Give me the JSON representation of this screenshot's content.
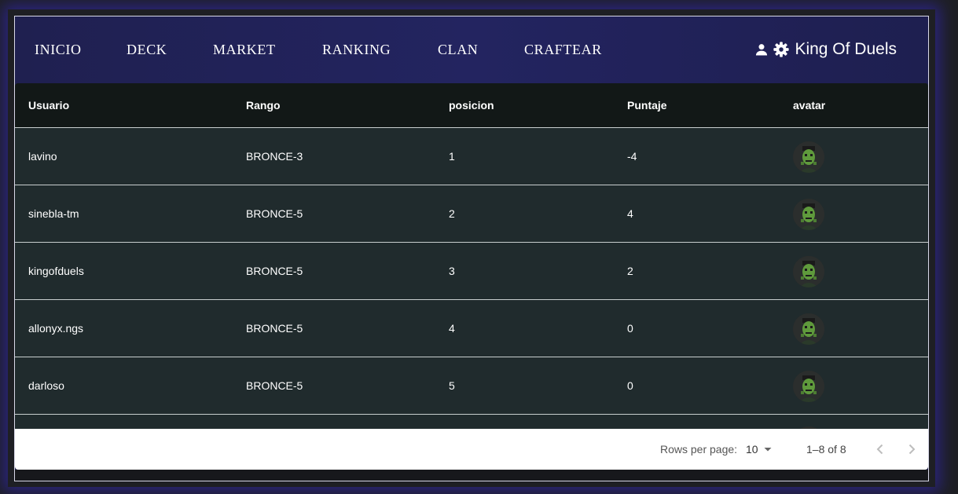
{
  "nav": {
    "items": [
      {
        "label": "INICIO"
      },
      {
        "label": "DECK"
      },
      {
        "label": "MARKET"
      },
      {
        "label": "RANKING"
      },
      {
        "label": "CLAN"
      },
      {
        "label": "CRAFTEAR"
      }
    ],
    "user_icon": "person-icon",
    "settings_icon": "gear-icon",
    "username": "King Of Duels"
  },
  "table": {
    "columns": [
      "Usuario",
      "Rango",
      "posicion",
      "Puntaje",
      "avatar"
    ],
    "rows": [
      {
        "usuario": "lavino",
        "rango": "BRONCE-3",
        "posicion": "1",
        "puntaje": "-4"
      },
      {
        "usuario": "sinebla-tm",
        "rango": "BRONCE-5",
        "posicion": "2",
        "puntaje": "4"
      },
      {
        "usuario": "kingofduels",
        "rango": "BRONCE-5",
        "posicion": "3",
        "puntaje": "2"
      },
      {
        "usuario": "allonyx.ngs",
        "rango": "BRONCE-5",
        "posicion": "4",
        "puntaje": "0"
      },
      {
        "usuario": "darloso",
        "rango": "BRONCE-5",
        "posicion": "5",
        "puntaje": "0"
      }
    ]
  },
  "pagination": {
    "rows_per_page_label": "Rows per page:",
    "rows_per_page_value": "10",
    "range_text": "1–8 of 8",
    "prev_icon": "chevron-left-icon",
    "next_icon": "chevron-right-icon"
  },
  "colors": {
    "nav_bg": "#1f2050",
    "table_bg": "#202b2d",
    "header_bg": "#121817",
    "glow": "#3428c8"
  }
}
